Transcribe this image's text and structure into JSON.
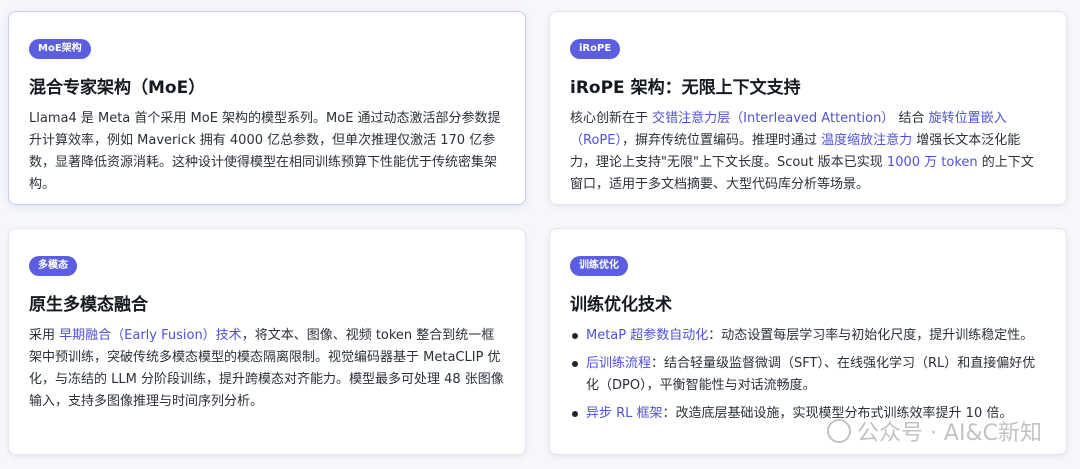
{
  "cards": [
    {
      "badge": "MoE架构",
      "title": "混合专家架构（MoE）",
      "body": "Llama4 是 Meta 首个采用 MoE 架构的模型系列。MoE 通过动态激活部分参数提升计算效率，例如 Maverick 拥有 4000 亿总参数，但单次推理仅激活 170 亿参数，显著降低资源消耗。这种设计使得模型在相同训练预算下性能优于传统密集架构。"
    },
    {
      "badge": "iRoPE",
      "title": "iRoPE 架构：无限上下文支持",
      "body": {
        "t1": "核心创新在于 ",
        "h1": "交错注意力层（Interleaved Attention）",
        "t2": " 结合 ",
        "h2": "旋转位置嵌入（RoPE）",
        "t3": "，摒弃传统位置编码。推理时通过 ",
        "h3": "温度缩放注意力",
        "t4": " 增强长文本泛化能力，理论上支持\"无限\"上下文长度。Scout 版本已实现 ",
        "h4": "1000 万 token",
        "t5": " 的上下文窗口，适用于多文档摘要、大型代码库分析等场景。"
      }
    },
    {
      "badge": "多模态",
      "title": "原生多模态融合",
      "body": {
        "t1": "采用 ",
        "h1": "早期融合（Early Fusion）技术",
        "t2": "，将文本、图像、视频 token 整合到统一框架中预训练，突破传统多模态模型的模态隔离限制。视觉编码器基于 MetaCLIP 优化，与冻结的 LLM 分阶段训练，提升跨模态对齐能力。模型最多可处理 48 张图像输入，支持多图像推理与时间序列分析。"
      }
    },
    {
      "badge": "训练优化",
      "title": "训练优化技术",
      "items": [
        {
          "hl": "MetaP 超参数自动化",
          "text": "：动态设置每层学习率与初始化尺度，提升训练稳定性。"
        },
        {
          "hl": "后训练流程",
          "text": "：结合轻量级监督微调（SFT）、在线强化学习（RL）和直接偏好优化（DPO），平衡智能性与对话流畅度。"
        },
        {
          "hl": "异步 RL 框架",
          "text": "：改造底层基础设施，实现模型分布式训练效率提升 10 倍。"
        }
      ]
    }
  ],
  "watermark": "公众号 · AI&C新知",
  "colors": {
    "accent": "#5b5ee0",
    "highlight": "#4f52d6"
  }
}
